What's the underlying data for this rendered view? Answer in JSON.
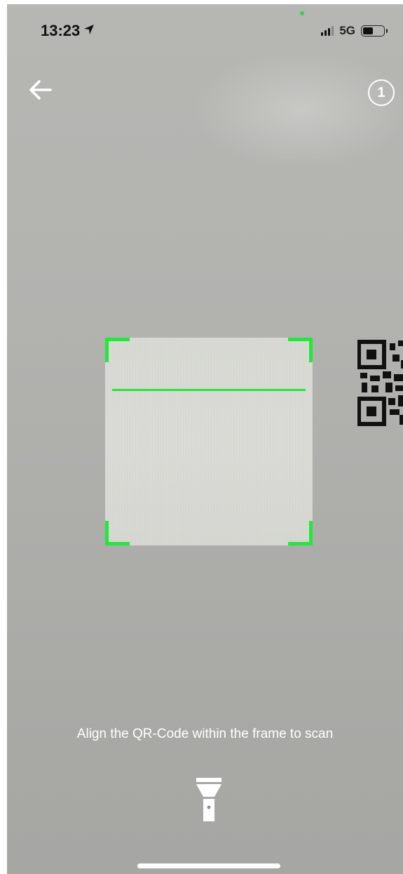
{
  "status_bar": {
    "time": "13:23",
    "network": "5G",
    "battery_level": 0.5,
    "location_icon": "location-arrow-icon"
  },
  "nav": {
    "back_icon": "arrow-left-icon",
    "count": "1"
  },
  "scanner": {
    "accent_color": "#22e83a",
    "hint": "Align the QR-Code within the frame to scan"
  },
  "controls": {
    "torch_icon": "flashlight-icon"
  }
}
